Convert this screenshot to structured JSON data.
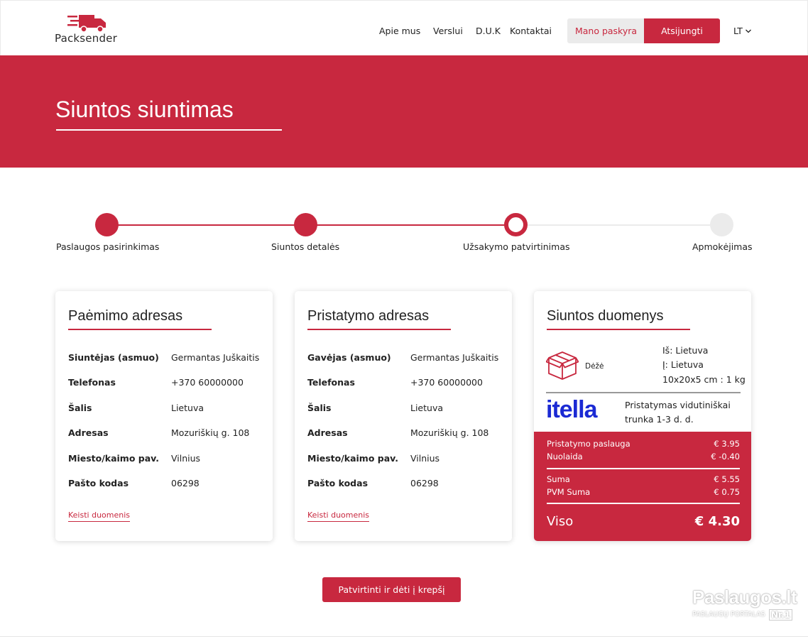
{
  "header": {
    "logo_text": "Packsender",
    "nav": [
      "Apie mus",
      "Verslui",
      "D.U.K",
      "Kontaktai"
    ],
    "account_label": "Mano paskyra",
    "logout_label": "Atsijungti",
    "language": "LT"
  },
  "hero": {
    "title": "Siuntos siuntimas"
  },
  "stepper": {
    "steps": [
      {
        "label": "Paslaugos pasirinkimas",
        "state": "done"
      },
      {
        "label": "Siuntos detalės",
        "state": "done"
      },
      {
        "label": "Užsakymo patvirtinimas",
        "state": "current"
      },
      {
        "label": "Apmokėjimas",
        "state": "todo"
      }
    ]
  },
  "pickup": {
    "title": "Paėmimo adresas",
    "rows": [
      {
        "label": "Siuntėjas (asmuo)",
        "value": "Germantas Juškaitis"
      },
      {
        "label": "Telefonas",
        "value": "+370 60000000"
      },
      {
        "label": "Šalis",
        "value": "Lietuva"
      },
      {
        "label": "Adresas",
        "value": "Mozuriškių g. 108"
      },
      {
        "label": "Miesto/kaimo pav.",
        "value": "Vilnius"
      },
      {
        "label": "Pašto kodas",
        "value": "06298"
      }
    ],
    "edit_label": "Keisti duomenis"
  },
  "delivery": {
    "title": "Pristatymo adresas",
    "rows": [
      {
        "label": "Gavėjas (asmuo)",
        "value": "Germantas Juškaitis"
      },
      {
        "label": "Telefonas",
        "value": "+370 60000000"
      },
      {
        "label": "Šalis",
        "value": "Lietuva"
      },
      {
        "label": "Adresas",
        "value": "Mozuriškių g. 108"
      },
      {
        "label": "Miesto/kaimo pav.",
        "value": "Vilnius"
      },
      {
        "label": "Pašto kodas",
        "value": "06298"
      }
    ],
    "edit_label": "Keisti duomenis"
  },
  "shipment": {
    "title": "Siuntos duomenys",
    "package_type": "Dėžė",
    "from": "Iš: Lietuva",
    "to": "Į: Lietuva",
    "dimensions": "10x20x5 cm : 1 kg",
    "carrier_name": "itella",
    "delivery_line1": "Pristatymas vidutiniškai",
    "delivery_line2": "trunka 1-3 d. d.",
    "prices": [
      {
        "label": "Pristatymo paslauga",
        "value": "€ 3.95"
      },
      {
        "label": "Nuolaida",
        "value": "€ -0.40"
      },
      {
        "label": "Suma",
        "value": "€ 5.55"
      },
      {
        "label": "PVM Suma",
        "value": "€ 0.75"
      }
    ],
    "total_label": "Viso",
    "total_value": "€ 4.30"
  },
  "cta_label": "Patvirtinti ir dėti į krepšį",
  "watermark": {
    "title": "Paslaugos.lt",
    "subtitle": "PASLAUGŲ PORTALAS",
    "badge": "Nr.1"
  },
  "colors": {
    "accent": "#c8283f",
    "carrier": "#1b2ad4",
    "inactive": "#ebebeb"
  }
}
